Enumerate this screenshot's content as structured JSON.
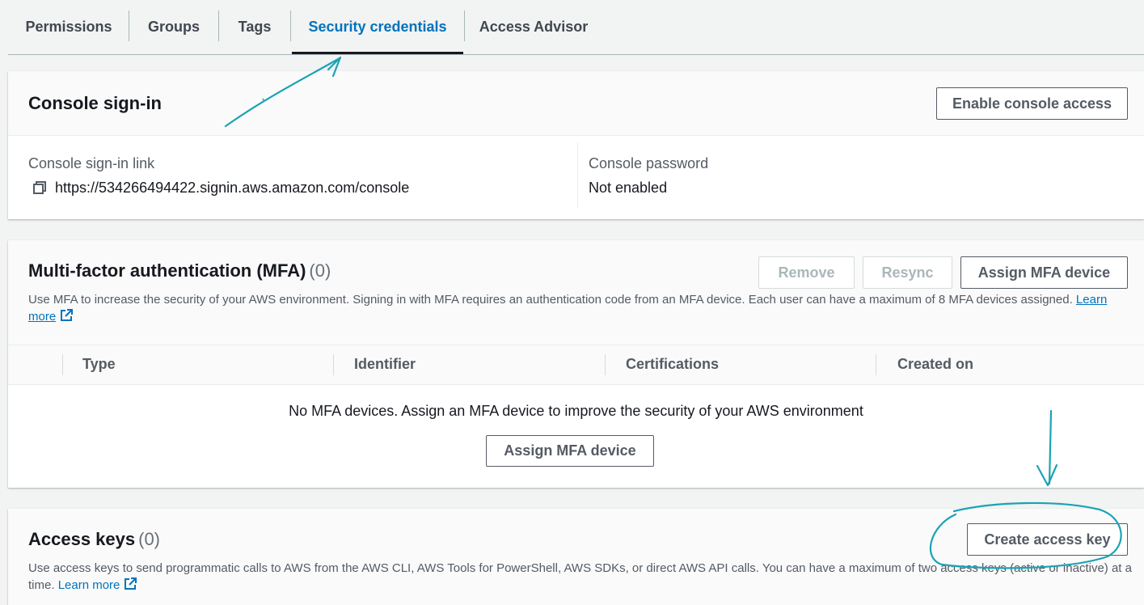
{
  "tabs": [
    {
      "label": "Permissions"
    },
    {
      "label": "Groups"
    },
    {
      "label": "Tags"
    },
    {
      "label": "Security credentials",
      "active": true
    },
    {
      "label": "Access Advisor"
    }
  ],
  "console_signin": {
    "title": "Console sign-in",
    "enable_button": "Enable console access",
    "link_label": "Console sign-in link",
    "link_value": "https://534266494422.signin.aws.amazon.com/console",
    "password_label": "Console password",
    "password_value": "Not enabled"
  },
  "mfa": {
    "title": "Multi-factor authentication (MFA)",
    "count": "(0)",
    "remove_button": "Remove",
    "resync_button": "Resync",
    "assign_button": "Assign MFA device",
    "description": "Use MFA to increase the security of your AWS environment. Signing in with MFA requires an authentication code from an MFA device. Each user can have a maximum of 8 MFA devices assigned.",
    "learn_more_part1": "Learn",
    "learn_more_part2": "more",
    "columns": [
      "Type",
      "Identifier",
      "Certifications",
      "Created on"
    ],
    "empty_text": "No MFA devices. Assign an MFA device to improve the security of your AWS environment",
    "empty_assign_button": "Assign MFA device"
  },
  "access_keys": {
    "title": "Access keys",
    "count": "(0)",
    "create_button": "Create access key",
    "description_line1": "Use access keys to send programmatic calls to AWS from the AWS CLI, AWS Tools for PowerShell, AWS SDKs, or direct AWS API calls. You can have a maximum of two access keys (active or inactive) at a",
    "description_line2": "time.",
    "learn_more": "Learn more"
  },
  "colors": {
    "accent": "#0073bb",
    "annotation": "#1aa3b5"
  }
}
